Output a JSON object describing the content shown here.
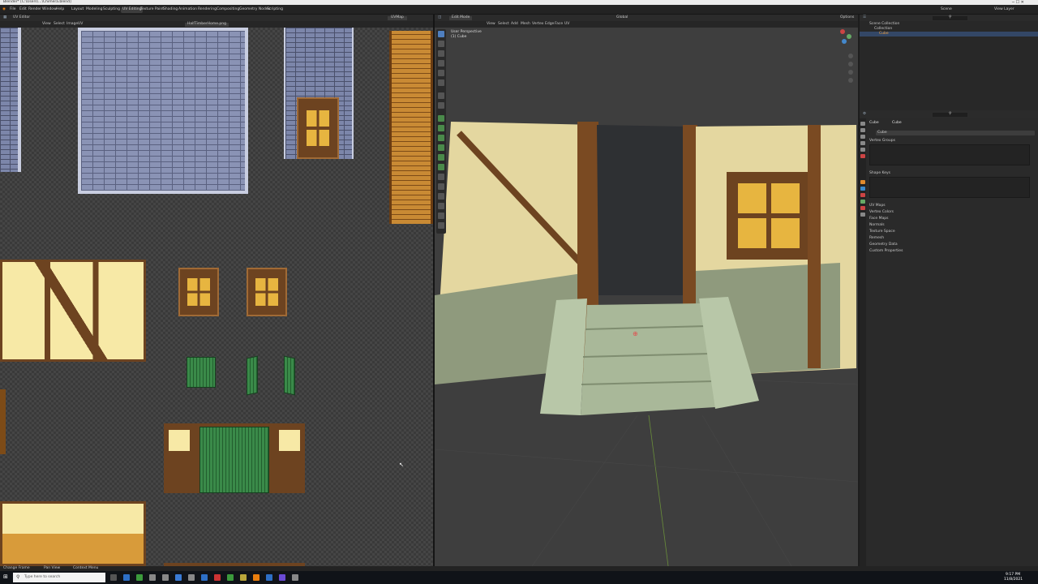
{
  "titlebar": {
    "title": "Blender* [C:\\Users\\...\\Chimera.blend]"
  },
  "menubar": {
    "items": [
      "File",
      "Edit",
      "Render",
      "Window",
      "Help"
    ],
    "workspaces": [
      "Layout",
      "Modeling",
      "Sculpting",
      "UV Editing",
      "Texture Paint",
      "Shading",
      "Animation",
      "Rendering",
      "Compositing",
      "Geometry Nodes",
      "Scripting"
    ],
    "active_workspace": "UV Editing",
    "scene": "Scene",
    "view_layer": "View Layer"
  },
  "uv_editor": {
    "mode": "UV Editor",
    "menus": [
      "View",
      "Select",
      "Image",
      "UV"
    ],
    "image_name": "HalfTimberHome.png"
  },
  "viewport": {
    "mode": "Edit Mode",
    "menus": [
      "View",
      "Select",
      "Add",
      "Mesh",
      "Vertex",
      "Edge",
      "Face",
      "UV"
    ],
    "perspective_label": "User Perspective",
    "object_label": "(1) Cube",
    "transform": "Global",
    "options": "Options"
  },
  "outliner": {
    "root": "Scene Collection",
    "collection": "Collection",
    "object": "Cube"
  },
  "properties": {
    "object": "Cube",
    "mesh": "Cube",
    "data_name": "Cube",
    "sections": {
      "vertex_groups": "Vertex Groups",
      "shape_keys": "Shape Keys"
    },
    "collapsed": [
      "UV Maps",
      "Vertex Colors",
      "Face Maps",
      "Normals",
      "Texture Space",
      "Remesh",
      "Geometry Data",
      "Custom Properties"
    ]
  },
  "statusbar": {
    "left": "Change Frame",
    "mid": "Pan View",
    "right": "Context Menu"
  },
  "taskbar": {
    "search_placeholder": "Type here to search",
    "time": "9:17 PM",
    "date": "11/8/2021"
  },
  "colors": {
    "accent": "#4f7fbf",
    "active_tool": "#4f7fbf"
  }
}
